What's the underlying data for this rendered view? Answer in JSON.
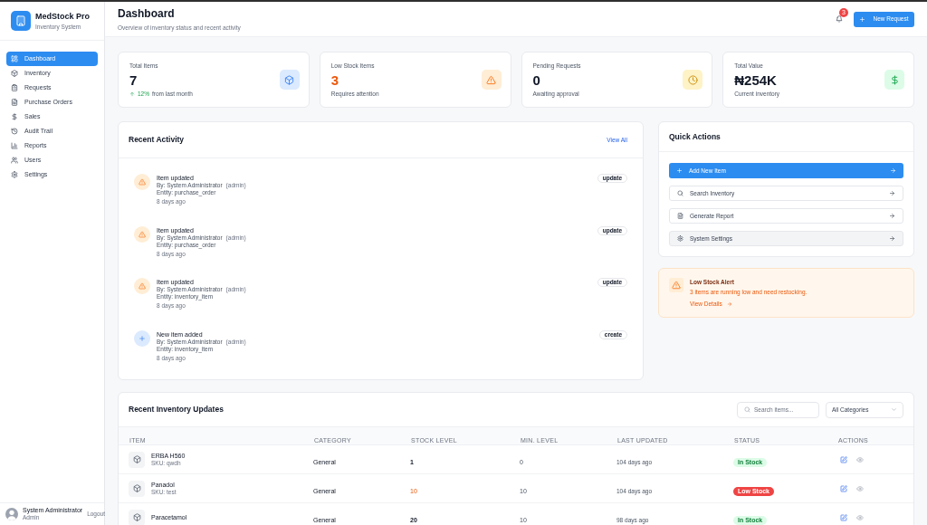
{
  "sidebar": {
    "app_name": "MedStock Pro",
    "app_subtitle": "Inventory System",
    "items": [
      {
        "label": "Dashboard",
        "selected": true
      },
      {
        "label": "Inventory",
        "selected": false
      },
      {
        "label": "Requests",
        "selected": false
      },
      {
        "label": "Purchase Orders",
        "selected": false
      },
      {
        "label": "Sales",
        "selected": false
      },
      {
        "label": "Audit Trail",
        "selected": false
      },
      {
        "label": "Reports",
        "selected": false
      },
      {
        "label": "Users",
        "selected": false
      },
      {
        "label": "Settings",
        "selected": false
      }
    ],
    "user": {
      "name": "System Administrator",
      "role": "Admin",
      "logout": "Logout"
    }
  },
  "header": {
    "title": "Dashboard",
    "subtitle": "Overview of inventory status and recent activity",
    "notification_count": "3",
    "button": "New Request"
  },
  "stats": [
    {
      "label": "Total Items",
      "value": "7",
      "alert": false,
      "change": "12%",
      "caption": "from last month",
      "color": "#dbeafe"
    },
    {
      "label": "Low Stock Items",
      "value": "3",
      "alert": true,
      "caption": "Requires attention",
      "color": "#ffedd5"
    },
    {
      "label": "Pending Requests",
      "value": "0",
      "alert": false,
      "caption": "Awaiting approval",
      "color": "#fef3c7"
    },
    {
      "label": "Total Value",
      "value": "₦254K",
      "alert": false,
      "caption": "Current inventory",
      "color": "#dcfce7"
    }
  ],
  "recent_activity": {
    "title": "Recent Activity",
    "link": "View All",
    "items": [
      {
        "kind": "update",
        "title": "Item updated",
        "user": "By: System Administrator",
        "role": "(admin)",
        "entity": "Entity: purchase_order",
        "time": "8 days ago",
        "badge": "update"
      },
      {
        "kind": "update",
        "title": "Item updated",
        "user": "By: System Administrator",
        "role": "(admin)",
        "entity": "Entity: purchase_order",
        "time": "8 days ago",
        "badge": "update"
      },
      {
        "kind": "update",
        "title": "Item updated",
        "user": "By: System Administrator",
        "role": "(admin)",
        "entity": "Entity: inventory_item",
        "time": "8 days ago",
        "badge": "update"
      },
      {
        "kind": "create",
        "title": "New item added",
        "user": "By: System Administrator",
        "role": "(admin)",
        "entity": "Entity: inventory_item",
        "time": "8 days ago",
        "badge": "create"
      }
    ]
  },
  "quick_actions": {
    "title": "Quick Actions",
    "items": [
      {
        "kind": "primary",
        "label": "Add New Item",
        "hovered": false
      },
      {
        "kind": "default",
        "label": "Search Inventory",
        "hovered": false
      },
      {
        "kind": "default",
        "label": "Generate Report",
        "hovered": false
      },
      {
        "kind": "default",
        "label": "System Settings",
        "hovered": true
      }
    ]
  },
  "alert": {
    "title": "Low Stock Alert",
    "message": "3 items are running low and need restocking.",
    "link": "View Details"
  },
  "inventory_table": {
    "title": "Recent Inventory Updates",
    "search": {
      "placeholder": "Search items..."
    },
    "filter": {
      "value": "All Categories"
    },
    "columns": [
      "ITEM",
      "CATEGORY",
      "STOCK LEVEL",
      "MIN. LEVEL",
      "LAST UPDATED",
      "STATUS",
      "ACTIONS"
    ],
    "rows": [
      {
        "item": "ERBA H560",
        "sku": "SKU: qwdh",
        "category": "General",
        "stock_level": "1",
        "low": false,
        "min_level": "0",
        "last_updated": "104 days ago",
        "status": "In Stock"
      },
      {
        "item": "Panadol",
        "sku": "SKU: test",
        "category": "General",
        "stock_level": "10",
        "low": true,
        "min_level": "10",
        "last_updated": "104 days ago",
        "status": "Low Stock"
      },
      {
        "item": "Paracetamol",
        "category": "General",
        "stock_level": "20",
        "low": false,
        "min_level": "10",
        "last_updated": "98 days ago",
        "status": "In Stock"
      }
    ]
  }
}
